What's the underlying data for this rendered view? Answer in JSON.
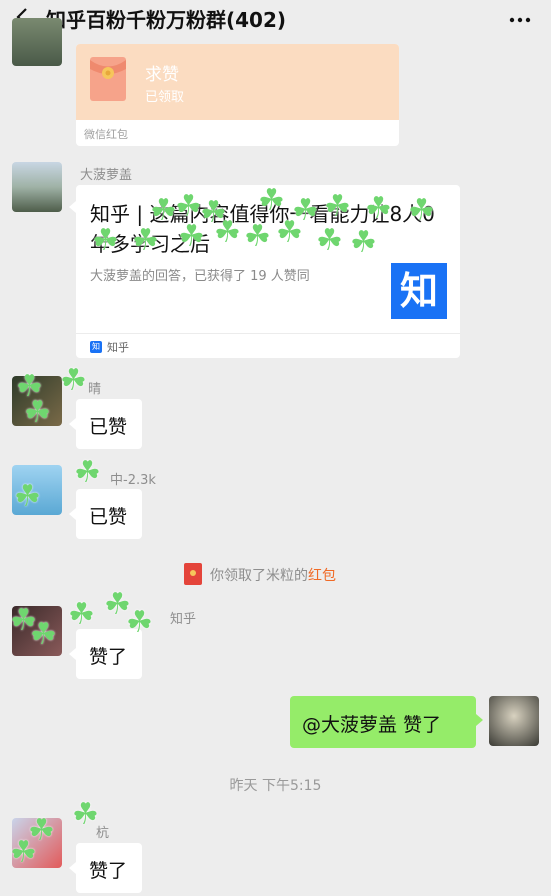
{
  "header": {
    "title": "知乎百粉千粉万粉群(402)",
    "back_icon": "chevron-left-icon",
    "more_icon": "more-dots-icon"
  },
  "messages": {
    "red_packet": {
      "title": "求赞",
      "status": "已领取",
      "footer": "微信红包",
      "color": "#fbdcc1"
    },
    "link_card": {
      "sender": "大菠萝盖",
      "title": "知乎 | 这篇内容值得你一看能力让8人0年多学习之后",
      "description": "大菠萝盖的回答，已获得了 19 人赞同",
      "logo_text": "知",
      "source_icon_text": "知",
      "source": "知乎",
      "logo_color": "#1972f5"
    },
    "msg_liked_1": {
      "sender": "晴",
      "text": "已赞"
    },
    "msg_liked_2": {
      "sender": "中-2.3k",
      "text": "已赞"
    },
    "system_notice": {
      "prefix": "你领取了米粒的",
      "link": "红包"
    },
    "msg_liked_3": {
      "sender": "知乎",
      "text": "赞了"
    },
    "my_message": {
      "text": "@大菠萝盖  赞了",
      "bubble_color": "#95ec69"
    },
    "timestamp": "昨天 下午5:15",
    "msg_liked_4": {
      "sender": "杭",
      "text": "赞了"
    }
  },
  "theme": {
    "background": "#ededed",
    "bubble_white": "#ffffff",
    "accent_orange": "#f06a26"
  }
}
